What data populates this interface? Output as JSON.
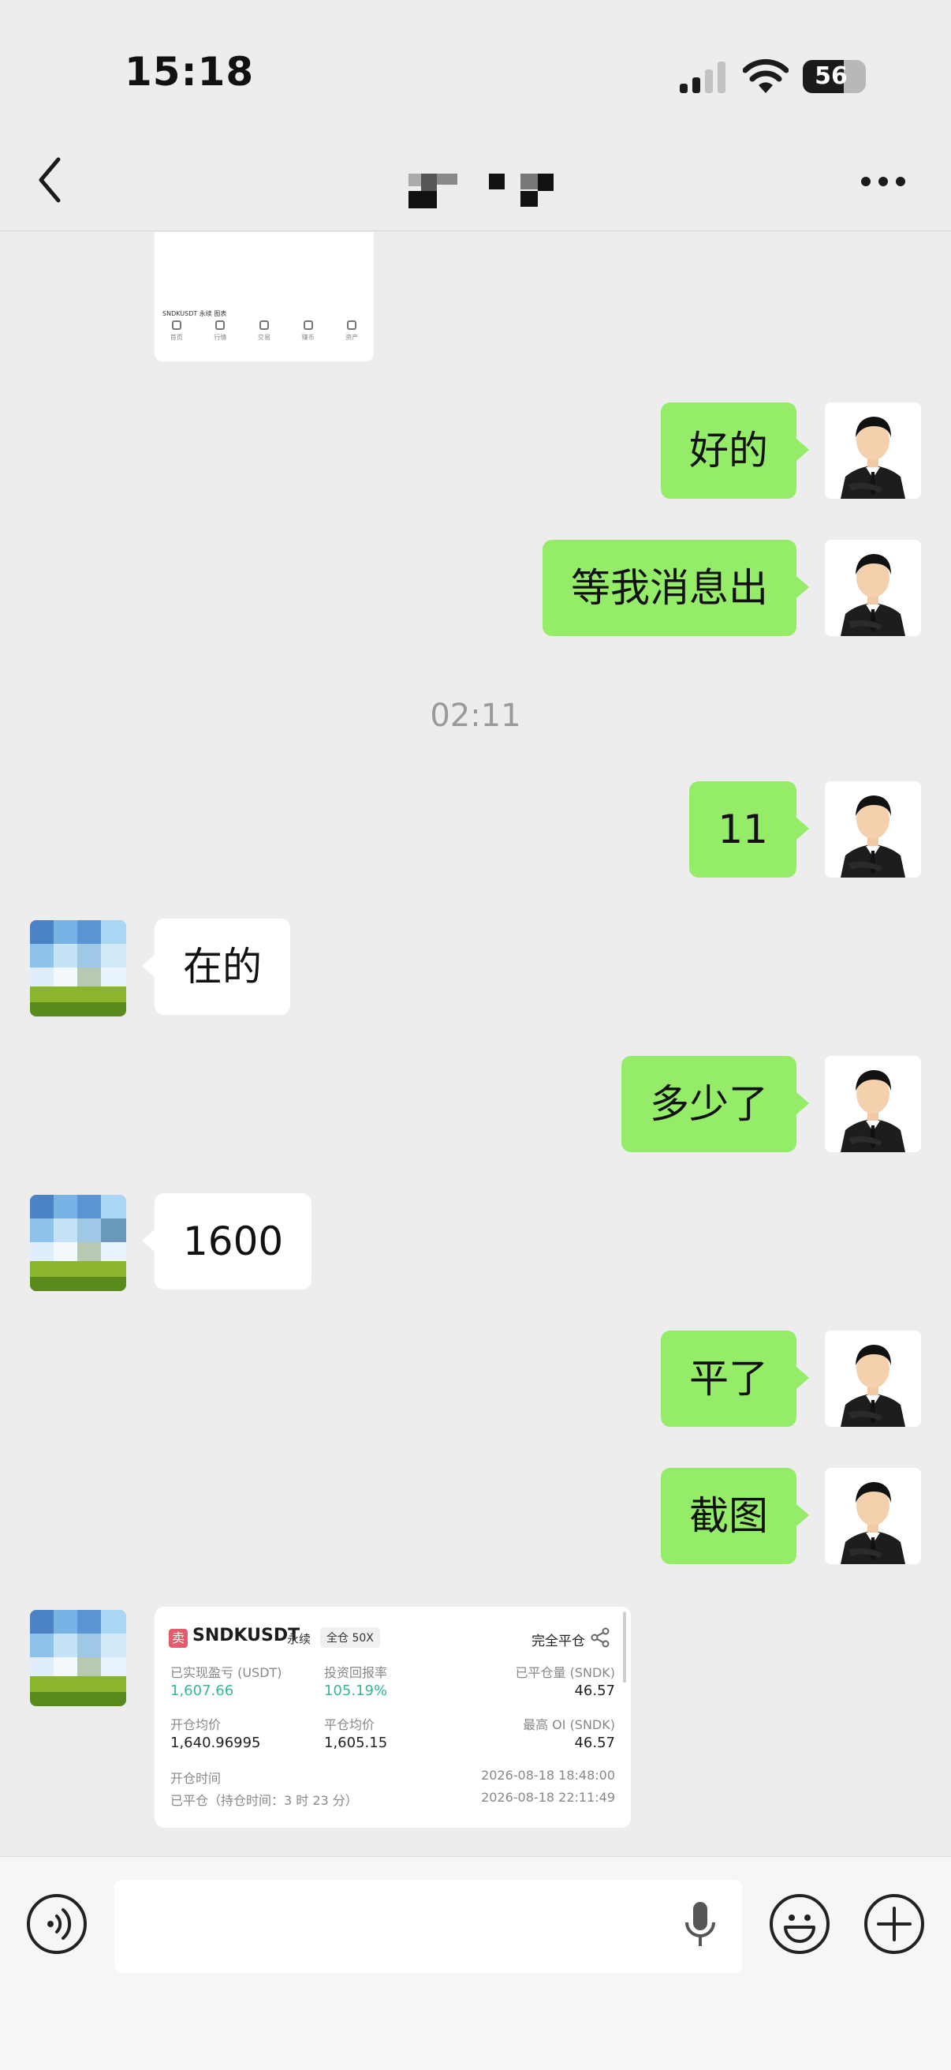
{
  "status_bar": {
    "time": "15:18",
    "battery_level": "56"
  },
  "header": {
    "title_pixelated": true,
    "more_icon": "ellipsis-icon",
    "back_icon": "chevron-left-icon"
  },
  "top_card": {
    "title": "SNDKUSDT 永续 图表",
    "nav": [
      "首页",
      "行情",
      "交易",
      "赚币",
      "资产"
    ]
  },
  "messages": [
    {
      "sender": "me",
      "text": "好的"
    },
    {
      "sender": "me",
      "text": "等我消息出"
    },
    {
      "type": "time",
      "text": "02:11"
    },
    {
      "sender": "me",
      "text": "11"
    },
    {
      "sender": "other",
      "text": "在的"
    },
    {
      "sender": "me",
      "text": "多少了"
    },
    {
      "sender": "other",
      "text": "1600"
    },
    {
      "sender": "me",
      "text": "平了"
    },
    {
      "sender": "me",
      "text": "截图"
    }
  ],
  "trade_card": {
    "badge": "卖",
    "symbol": "SNDKUSDT",
    "tag_perpetual": "永续",
    "tag_margin": "全仓 50X",
    "close_type": "完全平仓",
    "realized_pnl_label": "已实现盈亏 (USDT)",
    "realized_pnl_value": "1,607.66",
    "roi_label": "投资回报率",
    "roi_value": "105.19%",
    "closed_qty_label": "已平仓量 (SNDK)",
    "closed_qty_value": "46.57",
    "open_avg_label": "开仓均价",
    "open_avg_value": "1,640.96995",
    "close_avg_label": "平仓均价",
    "close_avg_value": "1,605.15",
    "max_oi_label": "最高 OI (SNDK)",
    "max_oi_value": "46.57",
    "open_time_label": "开仓时间",
    "open_time_value": "2026-08-18 18:48:00",
    "closed_label": "已平仓（持仓时间：3 时 23 分）",
    "closed_time_value": "2026-08-18 22:11:49"
  },
  "input_bar": {
    "voice_icon": "voice-icon",
    "mic_icon": "microphone-icon",
    "emoji_icon": "emoji-icon",
    "plus_icon": "plus-icon"
  },
  "colors": {
    "my_bubble": "#95ec69",
    "other_bubble": "#ffffff",
    "background": "#ededed",
    "green_value": "#35b79a"
  }
}
